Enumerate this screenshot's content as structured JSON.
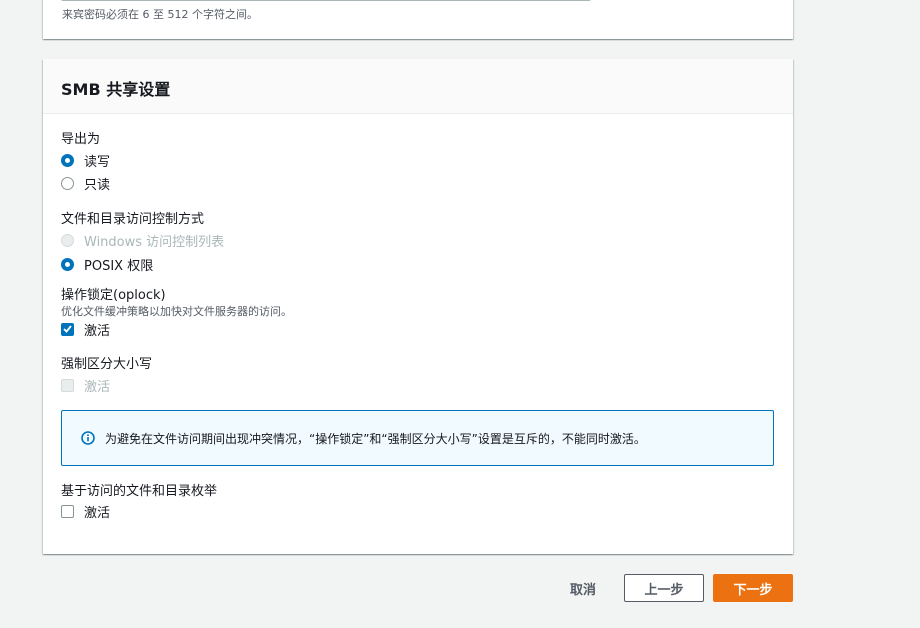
{
  "top_section": {
    "password_hint": "来宾密码必须在 6 至 512 个字符之间。"
  },
  "smb": {
    "title": "SMB 共享设置",
    "export_as": {
      "label": "导出为",
      "options": [
        "读写",
        "只读"
      ],
      "selected": "读写"
    },
    "access_control": {
      "label": "文件和目录访问控制方式",
      "options": [
        "Windows 访问控制列表",
        "POSIX 权限"
      ],
      "selected": "POSIX 权限",
      "disabled": [
        "Windows 访问控制列表"
      ]
    },
    "oplock": {
      "label": "操作锁定(oplock)",
      "description": "优化文件缓冲策略以加快对文件服务器的访问。",
      "checkbox_label": "激活",
      "checked": true
    },
    "case_sensitive": {
      "label": "强制区分大小写",
      "checkbox_label": "激活",
      "checked": false,
      "disabled": true
    },
    "info": {
      "icon": "info-icon",
      "text": "为避免在文件访问期间出现冲突情况，“操作锁定”和“强制区分大小写”设置是互斥的，不能同时激活。"
    },
    "access_based_enum": {
      "label": "基于访问的文件和目录枚举",
      "checkbox_label": "激活",
      "checked": false
    }
  },
  "actions": {
    "cancel": "取消",
    "previous": "上一步",
    "next": "下一步"
  },
  "colors": {
    "primary": "#ec7211",
    "accent": "#0073bb",
    "background": "#f2f3f3"
  }
}
